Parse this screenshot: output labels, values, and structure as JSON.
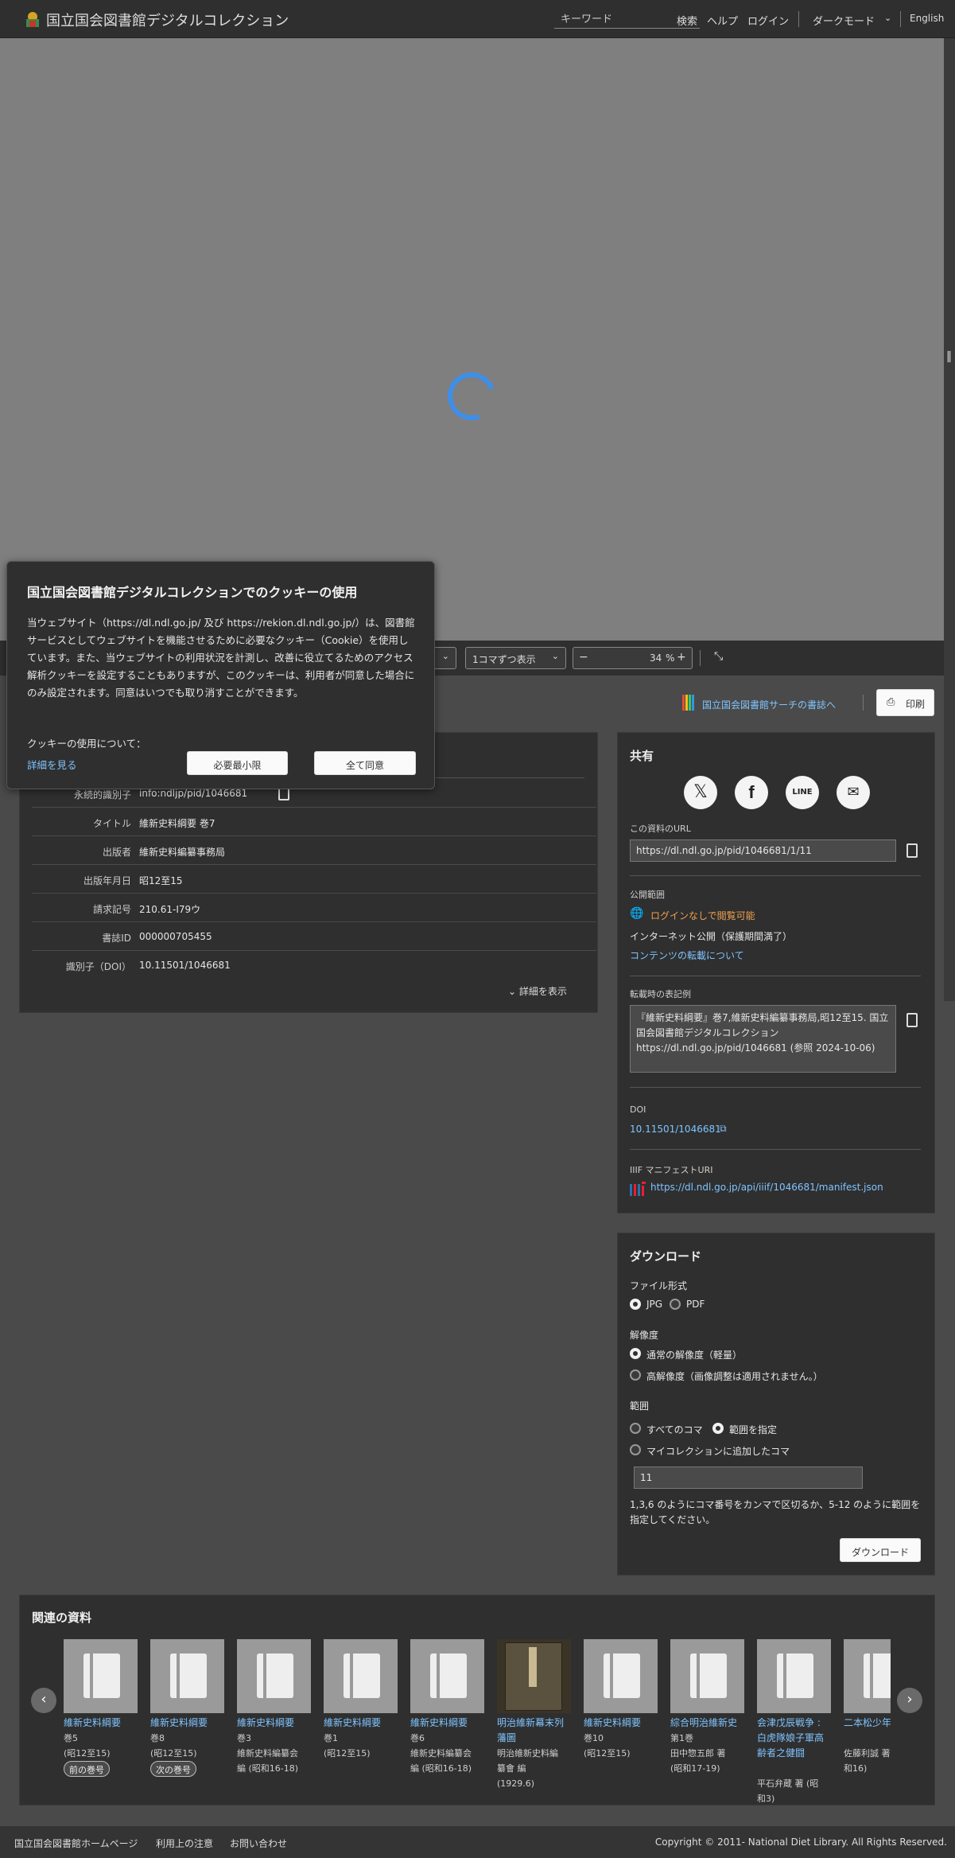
{
  "header": {
    "site_title": "国立国会図書館デジタルコレクション",
    "search_placeholder": "キーワード",
    "search_label": "検索",
    "help": "ヘルプ",
    "login": "ログイン",
    "dark_mode": "ダークモード",
    "english": "English"
  },
  "viewer": {
    "toolbar": {
      "display_mode": "1コマずつ表示",
      "zoom_value": "34",
      "zoom_unit": "%"
    }
  },
  "actions": {
    "ndl_search": "国立国会図書館サーチの書誌へ",
    "print": "印刷"
  },
  "bibliography": {
    "rows": [
      {
        "key": "永続的識別子",
        "value": "info:ndljp/pid/1046681"
      },
      {
        "key": "タイトル",
        "value": "維新史料綱要 巻7"
      },
      {
        "key": "出版者",
        "value": "維新史料編纂事務局"
      },
      {
        "key": "出版年月日",
        "value": "昭12至15"
      },
      {
        "key": "請求記号",
        "value": "210.61-I79ウ"
      },
      {
        "key": "書誌ID",
        "value": "000000705455"
      },
      {
        "key": "識別子（DOI）",
        "value": "10.11501/1046681"
      }
    ],
    "show_details": "詳細を表示"
  },
  "share": {
    "title": "共有",
    "icons": [
      "x-icon",
      "facebook-icon",
      "line-icon",
      "mail-icon"
    ],
    "url_label": "この資料のURL",
    "url_value": "https://dl.ndl.go.jp/pid/1046681/1/11",
    "scope_label": "公開範囲",
    "scope_status": "ログインなしで閲覧可能",
    "scope_detail": "インターネット公開（保護期間満了）",
    "reuse_link": "コンテンツの転載について",
    "citation_label": "転載時の表記例",
    "citation_text": "『維新史料綱要』巻7,維新史料編纂事務局,昭12至15. 国立国会図書館デジタルコレクション https://dl.ndl.go.jp/pid/1046681 (参照 2024-10-06)",
    "doi_label": "DOI",
    "doi_value": "10.11501/1046681",
    "iiif_label": "IIIF マニフェストURI",
    "iiif_value": "https://dl.ndl.go.jp/api/iiif/1046681/manifest.json"
  },
  "download": {
    "title": "ダウンロード",
    "format_label": "ファイル形式",
    "format_jpg": "JPG",
    "format_pdf": "PDF",
    "resolution_label": "解像度",
    "res_normal": "通常の解像度（軽量）",
    "res_high": "高解像度（画像調整は適用されません。）",
    "range_label": "範囲",
    "range_all": "すべてのコマ",
    "range_specify": "範囲を指定",
    "range_mycollection": "マイコレクションに追加したコマ",
    "range_value": "11",
    "range_help": "1,3,6 のようにコマ番号をカンマで区切るか、5-12 のように範囲を指定してください。",
    "button": "ダウンロード"
  },
  "related": {
    "title": "関連の資料",
    "items": [
      {
        "title": "維新史料綱要",
        "desc1": "巻5",
        "desc2": "(昭12至15)",
        "desc3": "",
        "badge": "前の巻号"
      },
      {
        "title": "維新史料綱要",
        "desc1": "巻8",
        "desc2": "(昭12至15)",
        "desc3": "",
        "badge": "次の巻号"
      },
      {
        "title": "維新史料綱要",
        "desc1": "巻3",
        "desc2": "維新史料編纂会",
        "desc3": "編 (昭和16-18)",
        "badge": ""
      },
      {
        "title": "維新史料綱要",
        "desc1": "巻1",
        "desc2": "(昭12至15)",
        "desc3": "",
        "badge": ""
      },
      {
        "title": "維新史料綱要",
        "desc1": "巻6",
        "desc2": "維新史料編纂会",
        "desc3": "編 (昭和16-18)",
        "badge": ""
      },
      {
        "title": "明治維新幕末列藩圖",
        "desc1": "明治維新史料編",
        "desc2": "纂會 編",
        "desc3": "(1929.6)",
        "badge": ""
      },
      {
        "title": "維新史料綱要",
        "desc1": "巻10",
        "desc2": "(昭12至15)",
        "desc3": "",
        "badge": ""
      },
      {
        "title": "綜合明治維新史",
        "desc1": "第1巻",
        "desc2": "田中惣五郎 著",
        "desc3": "(昭和17-19)",
        "badge": ""
      },
      {
        "title": "会津戊辰戦争 : 白虎隊娘子軍高齢者之健闘",
        "desc1": "平石弁蔵 著 (昭",
        "desc2": "和3)",
        "desc3": "",
        "badge": ""
      },
      {
        "title": "二本松少年隊話",
        "desc1": "佐藤利誠 著",
        "desc2": "和16)",
        "desc3": "",
        "badge": ""
      }
    ]
  },
  "cookie": {
    "title": "国立国会図書館デジタルコレクションでのクッキーの使用",
    "body": "当ウェブサイト（https://dl.ndl.go.jp/ 及び https://rekion.dl.ndl.go.jp/）は、図書館サービスとしてウェブサイトを機能させるために必要なクッキー（Cookie）を使用しています。また、当ウェブサイトの利用状況を計測し、改善に役立てるためのアクセス解析クッキーを設定することもありますが、このクッキーは、利用者が同意した場合にのみ設定されます。同意はいつでも取り消すことができます。",
    "usage_label": "クッキーの使用について：",
    "details_link": "詳細を見る",
    "minimum_button": "必要最小限",
    "accept_all_button": "全て同意"
  },
  "footer": {
    "links": [
      "国立国会図書館ホームページ",
      "利用上の注意",
      "お問い合わせ"
    ],
    "copyright": "Copyright © 2011- National Diet Library. All Rights Reserved."
  }
}
